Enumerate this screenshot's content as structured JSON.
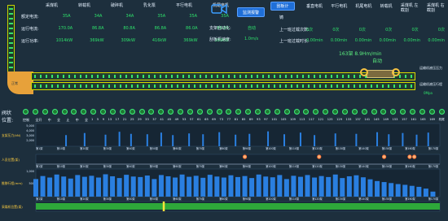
{
  "top_table": {
    "headers": [
      "采煤机",
      "转载机",
      "破碎机",
      "乳化泵",
      "平行电机",
      "机尾电机"
    ],
    "rows": [
      {
        "label": "额定电流:",
        "values": [
          "35A",
          "34A",
          "34A",
          "35A",
          "35A",
          "35A"
        ]
      },
      {
        "label": "运行电流:",
        "values": [
          "170.0A",
          "86.8A",
          "80.8A",
          "86.8A",
          "86.0A",
          "80.8A"
        ]
      },
      {
        "label": "运行功率:",
        "values": [
          "1014kW",
          "369kW",
          "309kW",
          "416kW",
          "369kW",
          "369kW"
        ]
      }
    ]
  },
  "support_auto": {
    "label": "支架自动化:",
    "value": "自动"
  },
  "scraper_speed": {
    "label": "刮板机速度:",
    "value": "1.0m/s"
  },
  "monitor_button": "监测报警",
  "stats_button": "刮板计",
  "right_table": {
    "headers": [
      "",
      "垂直电机",
      "平行电机",
      "机尾电机",
      "转载机",
      "采煤机 左截割",
      "采煤机 右截割"
    ],
    "rows": [
      {
        "label": "铸",
        "values": [
          "",
          "",
          "",
          "",
          "",
          ""
        ]
      },
      {
        "label": "上一班过载次数:",
        "values": [
          "0次",
          "0次",
          "0次",
          "0次",
          "0次",
          "0次"
        ]
      },
      {
        "label": "上一班过载时长:",
        "values": [
          "0.00min",
          "0.00min",
          "0.00min",
          "0.00min",
          "0.00min",
          "0.00min"
        ]
      }
    ]
  },
  "conveyor": {
    "position_text": "163架  8.9Hm/min",
    "mode_text": "自动",
    "right_label_1": "运输机液压压力",
    "right_label_2": "运输机液压行程",
    "right_value": "0Mpa",
    "left_status": "正常"
  },
  "valve": {
    "label_1": "阀状",
    "label_2": "位置:",
    "sample_labels": [
      "控制",
      "全开",
      "中",
      "全",
      "止",
      "中",
      "全"
    ]
  },
  "support_numbers": [
    "1",
    "5",
    "9",
    "13",
    "17",
    "21",
    "25",
    "29",
    "33",
    "37",
    "41",
    "45",
    "49",
    "53",
    "57",
    "61",
    "65",
    "69",
    "73",
    "77",
    "81",
    "85",
    "89",
    "93",
    "97",
    "101",
    "105",
    "109",
    "113",
    "117",
    "121",
    "125",
    "129",
    "133",
    "137",
    "141",
    "145",
    "149",
    "153",
    "157",
    "161",
    "165",
    "169",
    "机尾"
  ],
  "axis_labels": [
    "第1架",
    "第10架",
    "第20架",
    "第30架",
    "第40架",
    "第50架",
    "第60架",
    "第70架",
    "第80架",
    "第90架",
    "第100架",
    "第110架",
    "第120架",
    "第130架",
    "第140架",
    "第150架",
    "第160架",
    "第170架"
  ],
  "charts": [
    {
      "title": "支架压力(kN)",
      "yticks": [
        "5,000",
        "4,000",
        "3,000",
        "2,000"
      ],
      "color": "#2a7fe0"
    },
    {
      "title": "人员位置(架)",
      "yticks": [],
      "color": "#ff7b2a"
    },
    {
      "title": "推移行程(mm)",
      "yticks": [
        "1,000",
        "500"
      ],
      "color": "#2a7fe0"
    },
    {
      "title": "采煤机位置(架)",
      "yticks": [],
      "color": "#3bd044"
    }
  ],
  "chart_data": [
    {
      "type": "bar",
      "title": "支架压力(kN)",
      "x": [
        14,
        22,
        31,
        37,
        42,
        49,
        55,
        60,
        67,
        73,
        80,
        87,
        93,
        101,
        108,
        115,
        121,
        130,
        139,
        148,
        153,
        159,
        165,
        170
      ],
      "values": [
        2700,
        3200,
        2800,
        3500,
        3000,
        2900,
        3300,
        2700,
        3100,
        2900,
        3400,
        2800,
        3000,
        3600,
        2900,
        3300,
        2700,
        3100,
        3000,
        3400,
        2900,
        3200,
        2800,
        3300
      ],
      "ylim": [
        0,
        5500
      ],
      "ylabel": "支架压力(kN)"
    },
    {
      "type": "scatter",
      "title": "人员位置(架)",
      "x": [
        91,
        123,
        151,
        162,
        164
      ],
      "values": [
        1,
        1,
        1,
        1,
        1
      ]
    },
    {
      "type": "bar",
      "title": "推移行程(mm)",
      "x": [
        1,
        4,
        7,
        10,
        13,
        16,
        19,
        22,
        25,
        28,
        31,
        34,
        37,
        40,
        43,
        46,
        49,
        52,
        55,
        58,
        61,
        64,
        67,
        70,
        73,
        76,
        79,
        82,
        85,
        88,
        91,
        94,
        97,
        100,
        103,
        106,
        109,
        112,
        115,
        118,
        121,
        124,
        127,
        130,
        133,
        136,
        139,
        142,
        145,
        148,
        151,
        154,
        157,
        160,
        163,
        166,
        169,
        172
      ],
      "values": [
        700,
        820,
        760,
        880,
        800,
        720,
        860,
        790,
        830,
        760,
        890,
        810,
        740,
        870,
        800,
        780,
        840,
        700,
        860,
        810,
        760,
        880,
        790,
        830,
        750,
        870,
        800,
        760,
        850,
        780,
        820,
        740,
        880,
        800,
        770,
        860,
        700,
        830,
        790,
        860,
        760,
        820,
        780,
        880,
        740,
        810,
        850,
        770,
        690,
        620,
        580,
        540,
        500,
        470,
        430,
        390,
        320,
        200
      ],
      "ylim": [
        0,
        1100
      ],
      "ylabel": "推移行程(mm)"
    },
    {
      "type": "bar",
      "title": "采煤机位置(架)",
      "x": [
        1,
        175
      ],
      "values": [
        1,
        1
      ],
      "highlight_x": 56
    }
  ]
}
